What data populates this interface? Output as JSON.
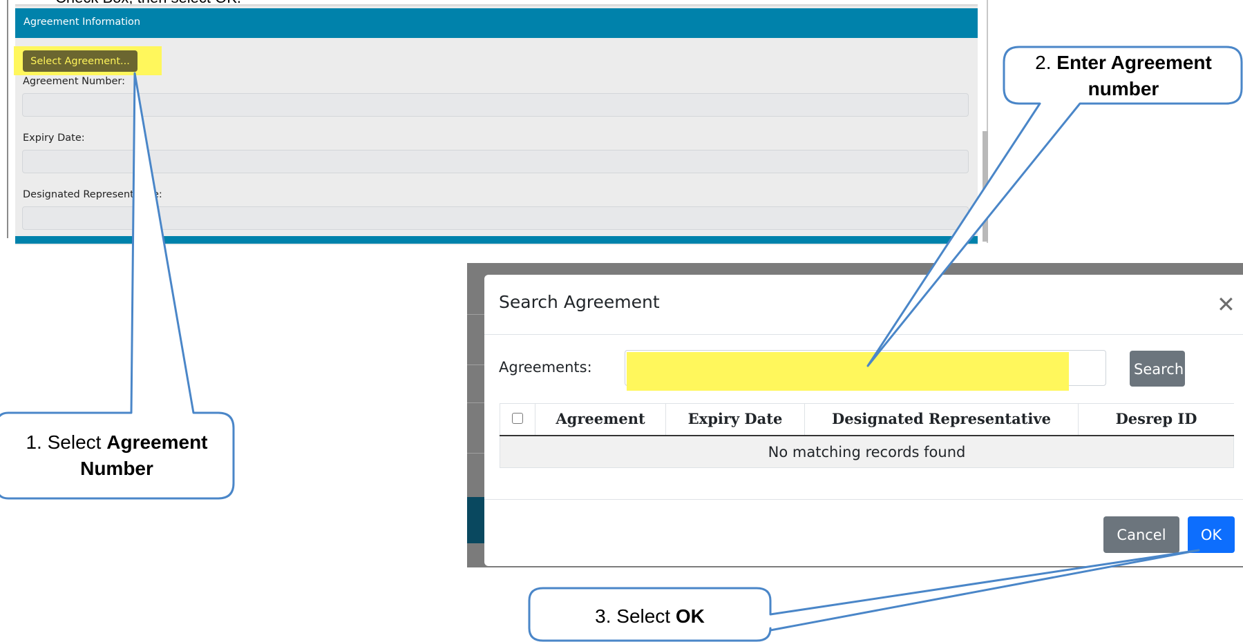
{
  "instruction_caption": "Check Box, then select OK.",
  "agreement_panel": {
    "header_title": "Agreement Information",
    "select_button_label": "Select Agreement...",
    "fields": [
      {
        "label": "Agreement Number:"
      },
      {
        "label": "Expiry Date:"
      },
      {
        "label": "Designated Representative:"
      }
    ]
  },
  "modal": {
    "title": "Search Agreement",
    "close_icon": "close-icon",
    "agreements_label": "Agreements:",
    "agreements_value": "",
    "search_button_label": "Search",
    "table": {
      "columns": [
        "Agreement",
        "Expiry Date",
        "Designated Representative",
        "Desrep ID"
      ],
      "empty_message": "No matching records found"
    },
    "cancel_button_label": "Cancel",
    "ok_button_label": "OK"
  },
  "callouts": [
    {
      "number": "1.",
      "prefix": "Select",
      "bold": "Agreement Number"
    },
    {
      "number": "2.",
      "prefix": "",
      "bold": "Enter Agreement number"
    },
    {
      "number": "3.",
      "prefix": "Select",
      "bold": "OK"
    }
  ],
  "colors": {
    "panel_header": "#0082ab",
    "highlight": "#fff75c",
    "callout_border": "#4a86c8",
    "ok_button": "#0d6efd",
    "secondary_button": "#6c757d"
  }
}
